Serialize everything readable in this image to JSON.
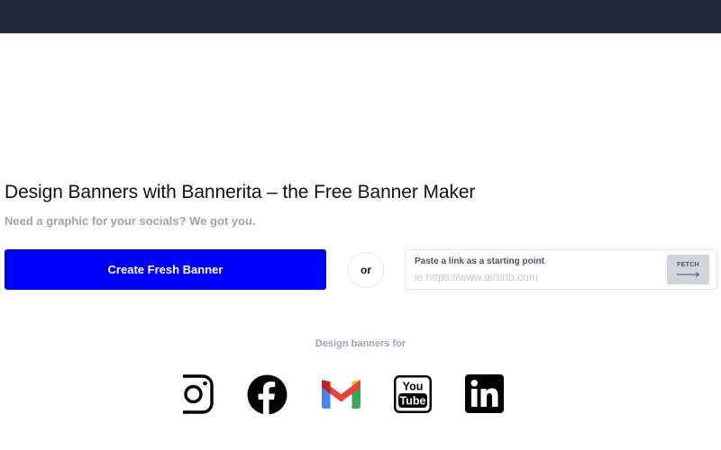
{
  "hero": {
    "title": "Design Banners with Bannerita – the Free Banner Maker",
    "subtitle": "Need a graphic for your socials? We got you."
  },
  "actions": {
    "create_label": "Create Fresh Banner",
    "or_label": "or",
    "link_label": "Paste a link as a starting point",
    "link_placeholder": "ie https://www.airbnb.com",
    "link_value": "",
    "fetch_label": "FETCH"
  },
  "platforms": {
    "heading": "Design banners for",
    "icons": [
      "instagram-icon",
      "facebook-icon",
      "gmail-icon",
      "youtube-icon",
      "linkedin-icon"
    ]
  },
  "colors": {
    "topbar": "#1f2937",
    "primary": "#0000ff",
    "muted_text": "#9ca3af"
  }
}
